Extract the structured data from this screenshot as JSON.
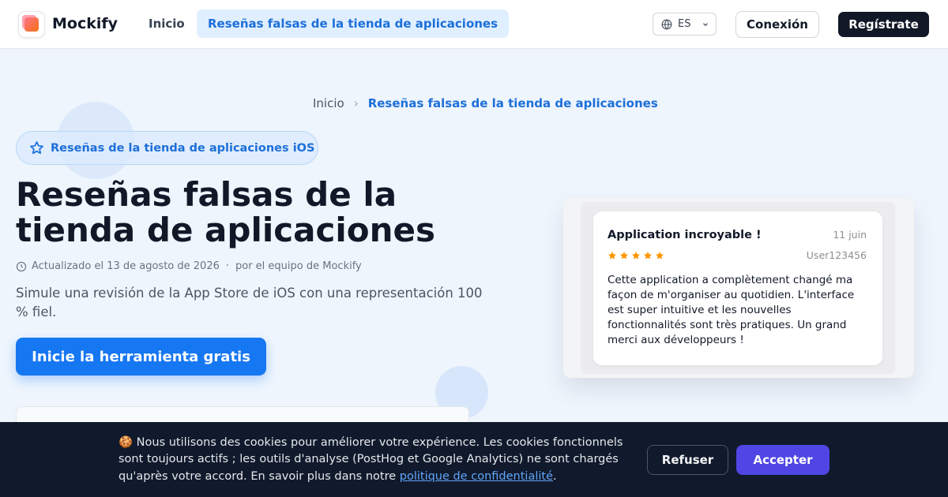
{
  "header": {
    "brand": "Mockify",
    "nav_home": "Inicio",
    "nav_active": "Reseñas falsas de la tienda de aplicaciones",
    "lang": "ES",
    "login": "Conexión",
    "signup": "Regístrate"
  },
  "breadcrumb": {
    "home": "Inicio",
    "separator": "›",
    "current": "Reseñas falsas de la tienda de aplicaciones"
  },
  "hero": {
    "badge": "Reseñas de la tienda de aplicaciones iOS",
    "title": "Reseñas falsas de la tienda de aplicaciones",
    "updated": "Actualizado el 13 de agosto de 2026",
    "meta_dot": "·",
    "author": "por el equipo de Mockify",
    "description": "Simule una revisión de la App Store de iOS con una representación 100 % fiel.",
    "cta": "Inicie la herramienta gratis"
  },
  "review": {
    "title": "Application incroyable !",
    "date": "11 juin",
    "rating": 5,
    "user": "User123456",
    "text": "Cette application a complètement changé ma façon de m'organiser au quotidien. L'interface est super intuitive et les nouvelles fonctionnalités sont très pratiques. Un grand merci aux développeurs !"
  },
  "cookie": {
    "emoji": "🍪",
    "text": "Nous utilisons des cookies pour améliorer votre expérience. Les cookies fonctionnels sont toujours actifs ; les outils d'analyse (PostHog et Google Analytics) ne sont chargés qu'après votre accord. En savoir plus dans notre",
    "link": "politique de confidentialité",
    "end": ".",
    "refuse": "Refuser",
    "accept": "Accepter"
  },
  "colors": {
    "accent": "#1677f2",
    "dark": "#111827",
    "star": "#ff9500",
    "accept": "#4f46e5",
    "banner": "#101a2c"
  },
  "icons": {
    "logo": "mockify-logo-icon",
    "lang": "globe-icon",
    "lang_chevron": "chevron-down-icon",
    "badge": "star-outline-icon",
    "meta": "clock-icon",
    "stars": "star-icon"
  }
}
